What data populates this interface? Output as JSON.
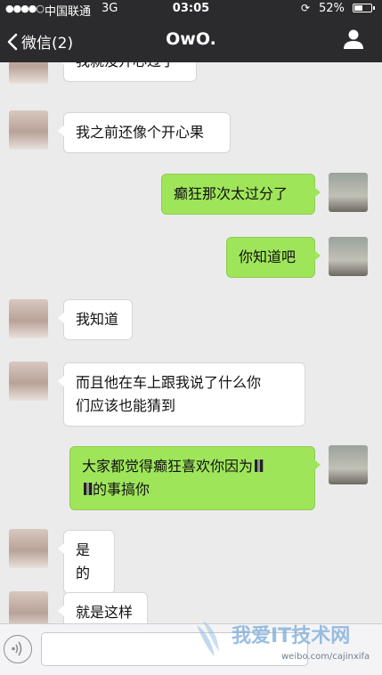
{
  "status_bar": {
    "signal": "●●●●○",
    "carrier": "中国联通",
    "network": "3G",
    "time": "03:05",
    "battery_percent": "52%",
    "battery_level": 0.52
  },
  "nav": {
    "back_label": "微信(2)",
    "title": "OwO."
  },
  "messages": [
    {
      "side": "recv",
      "text": "我就没开心过了"
    },
    {
      "side": "recv",
      "text": "我之前还像个开心果"
    },
    {
      "side": "sent",
      "text": "癫狂那次太过分了"
    },
    {
      "side": "sent",
      "text": "你知道吧"
    },
    {
      "side": "recv",
      "text": "我知道"
    },
    {
      "side": "recv",
      "text_line1": "而且他在车上跟我说了什么你",
      "text_line2": "们应该也能猜到"
    },
    {
      "side": "sent",
      "text_line1": "大家都觉得癫狂喜欢你因为",
      "text_line2": "的事搞你"
    },
    {
      "side": "recv",
      "text": "是的"
    },
    {
      "side": "recv",
      "text": "就是这样"
    }
  ],
  "watermark": {
    "main": "我爱IT技术网",
    "sub": "weibo.com/cajinxifa"
  },
  "icons": [
    "chevron-left-icon",
    "profile-icon",
    "voice-icon",
    "lock-rotation-icon",
    "battery-icon"
  ]
}
